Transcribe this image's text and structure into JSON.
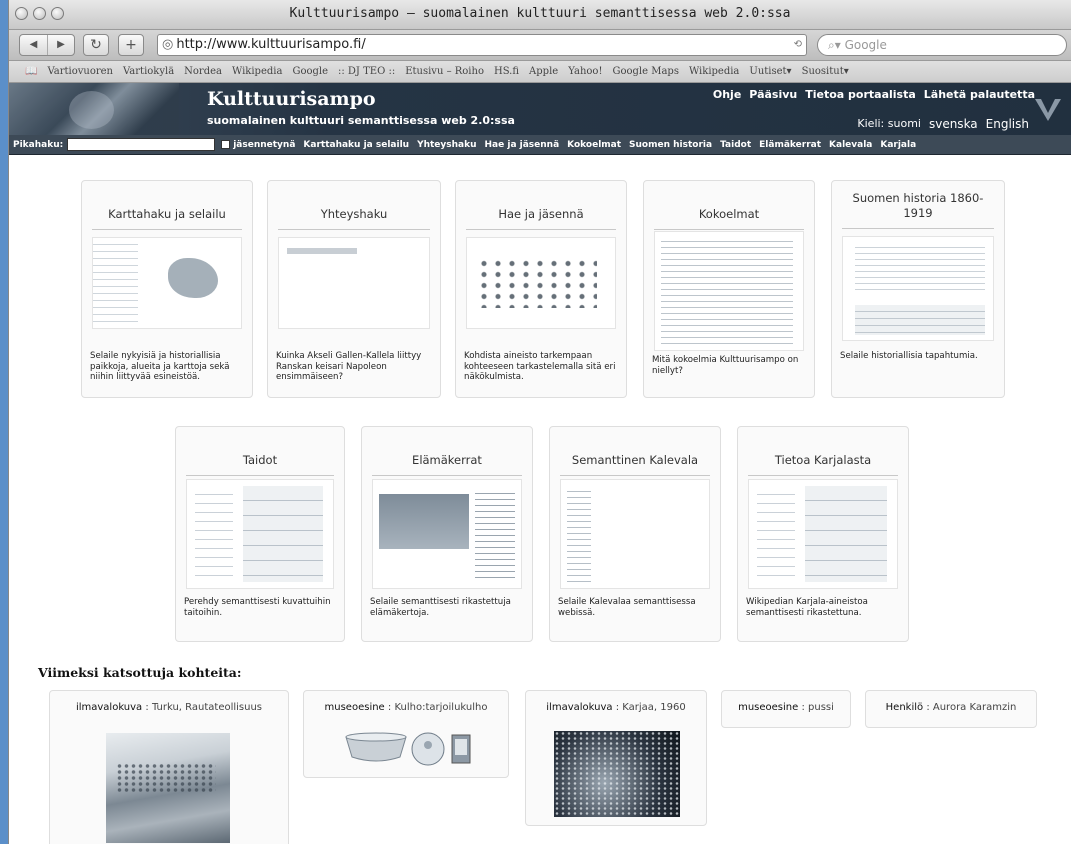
{
  "window": {
    "title": "Kulttuurisampo – suomalainen kulttuuri semanttisessa web 2.0:ssa"
  },
  "toolbar": {
    "url": "http://www.kulttuurisampo.fi/",
    "search_placeholder": "Google"
  },
  "bookmarks": [
    "Vartiovuoren",
    "Vartiokylä",
    "Nordea",
    "Wikipedia",
    "Google",
    ":: DJ TEO ::",
    "Etusivu – Roiho",
    "HS.fi",
    "Apple",
    "Yahoo!",
    "Google Maps",
    "Wikipedia",
    "Uutiset▾",
    "Suositut▾"
  ],
  "site": {
    "title": "Kulttuurisampo",
    "subtitle": "suomalainen kulttuuri semanttisessa web 2.0:ssa",
    "top_links": [
      "Ohje",
      "Pääsivu",
      "Tietoa portaalista",
      "Lähetä palautetta"
    ],
    "lang_label": "Kieli: suomi",
    "langs": [
      "svenska",
      "English"
    ]
  },
  "sitenav": {
    "quicksearch_label": "Pikahaku:",
    "checkbox_label": "jäsennetynä",
    "items": [
      "Karttahaku ja selailu",
      "Yhteyshaku",
      "Hae ja jäsennä",
      "Kokoelmat",
      "Suomen historia",
      "Taidot",
      "Elämäkerrat",
      "Kalevala",
      "Karjala"
    ]
  },
  "cards": [
    {
      "title": "Karttahaku ja selailu",
      "desc": "Selaile nykyisiä ja historiallisia paikkoja, alueita ja karttoja sekä niihin liittyvää esineistöä."
    },
    {
      "title": "Yhteyshaku",
      "desc": "Kuinka Akseli Gallen-Kallela liittyy Ranskan keisari Napoleon ensimmäiseen?"
    },
    {
      "title": "Hae ja jäsennä",
      "desc": "Kohdista aineisto tarkempaan kohteeseen tarkastelemalla sitä eri näkökulmista."
    },
    {
      "title": "Kokoelmat",
      "desc": "Mitä kokoelmia Kulttuurisampo on niellyt?"
    },
    {
      "title": "Suomen historia 1860-1919",
      "desc": "Selaile historiallisia tapahtumia."
    },
    {
      "title": "Taidot",
      "desc": "Perehdy semanttisesti kuvattuihin taitoihin."
    },
    {
      "title": "Elämäkerrat",
      "desc": "Selaile semanttisesti rikastettuja elämäkertoja."
    },
    {
      "title": "Semanttinen Kalevala",
      "desc": "Selaile Kalevalaa semanttisessa webissä."
    },
    {
      "title": "Tietoa Karjalasta",
      "desc": "Wikipedian Karjala-aineistoa semanttisesti rikastettuna."
    }
  ],
  "recent": {
    "heading": "Viimeksi katsottuja kohteita:",
    "items": [
      {
        "type": "ilmavalokuva",
        "name": "Turku, Rautateollisuus"
      },
      {
        "type": "museoesine",
        "name": "Kulho:tarjoilukulho"
      },
      {
        "type": "ilmavalokuva",
        "name": "Karjaa, 1960"
      },
      {
        "type": "museoesine",
        "name": "pussi"
      },
      {
        "type": "Henkilö",
        "name": "Aurora Karamzin"
      }
    ]
  }
}
